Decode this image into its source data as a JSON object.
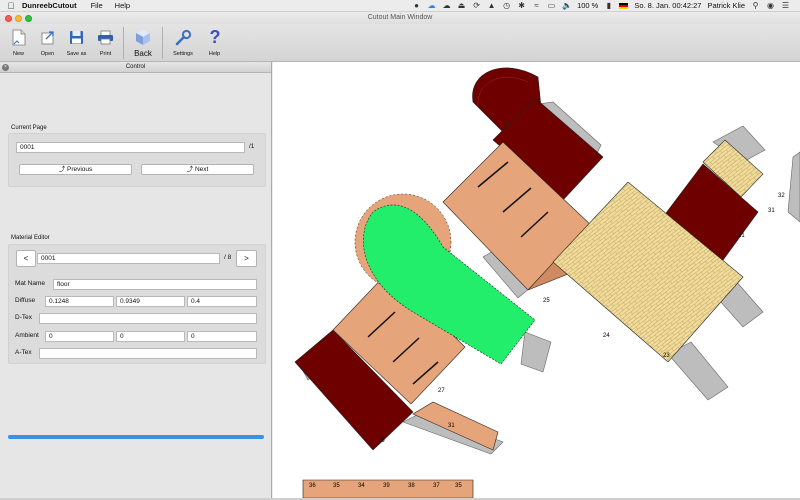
{
  "menubar": {
    "app_name": "DunreebCutout",
    "menus": [
      "File",
      "Help"
    ],
    "battery": "100 %",
    "datetime": "So. 8. Jan.  00:42:27",
    "user": "Patrick Klie"
  },
  "window": {
    "title": "Cutout Main Window"
  },
  "toolbar": {
    "new_label": "New",
    "open_label": "Open",
    "save_as_label": "Save as",
    "print_label": "Print",
    "back_label": "Back",
    "settings_label": "Settings",
    "help_label": "Help"
  },
  "control_panel": {
    "title": "Control",
    "current_page": {
      "section_label": "Current Page",
      "value": "0001",
      "total": "/1",
      "previous_label": "Previous",
      "next_label": "Next"
    },
    "material_editor": {
      "section_label": "Material Editor",
      "prev_symbol": "<",
      "next_symbol": ">",
      "index_value": "0001",
      "total": "/ 8",
      "mat_name_label": "Mat Name",
      "mat_name_value": "floor",
      "diffuse_label": "Diffuse",
      "diffuse": [
        "0.1248",
        "0.9349",
        "0.4"
      ],
      "dtex_label": "D-Tex",
      "dtex_value": "",
      "ambient_label": "Ambient",
      "ambient": [
        "0",
        "0",
        "0"
      ],
      "atex_label": "A-Tex",
      "atex_value": ""
    },
    "progress": 1.0
  },
  "canvas": {
    "fold_numbers": [
      "18",
      "19",
      "20",
      "21",
      "22",
      "23",
      "24",
      "25",
      "26",
      "27",
      "28",
      "29",
      "30",
      "31",
      "32",
      "33",
      "34",
      "35",
      "36",
      "37",
      "38",
      "39",
      "40"
    ]
  },
  "colors": {
    "green_face": "#22ee6c",
    "brick": "#f2dc9a",
    "roof": "#6e0000",
    "wall": "#e6a47a",
    "progress": "#3d8fe0"
  }
}
